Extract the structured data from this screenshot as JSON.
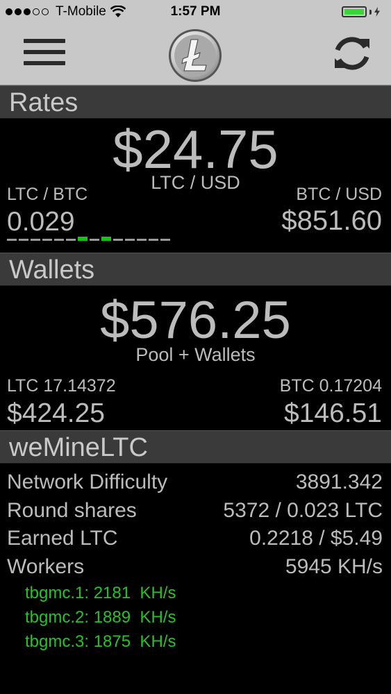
{
  "status_bar": {
    "carrier": "T-Mobile",
    "time": "1:57 PM",
    "signal_dots_filled": 3,
    "signal_dots_total": 5,
    "wifi_icon": "wifi-icon",
    "battery_level": 1.0,
    "battery_color": "#35d835"
  },
  "nav": {
    "menu_icon": "hamburger-menu-icon",
    "logo_icon": "litecoin-logo-icon",
    "refresh_icon": "refresh-icon"
  },
  "rates": {
    "header": "Rates",
    "ltc_usd_value": "$24.75",
    "ltc_usd_label": "LTC / USD",
    "ltc_btc_label": "LTC / BTC",
    "ltc_btc_value": "0.029",
    "btc_usd_label": "BTC / USD",
    "btc_usd_value": "$851.60",
    "sparkline": [
      0,
      0,
      0,
      0,
      0,
      0,
      1,
      0,
      1,
      0,
      0,
      0,
      0,
      0
    ],
    "sparkline_up_color": "#19c119"
  },
  "wallets": {
    "header": "Wallets",
    "total_value": "$576.25",
    "total_label": "Pool + Wallets",
    "ltc_label": "LTC 17.14372",
    "ltc_value": "$424.25",
    "btc_label": "BTC 0.17204",
    "btc_value": "$146.51"
  },
  "pool": {
    "header": "weMineLTC",
    "rows": [
      {
        "label": "Network Difficulty",
        "value": "3891.342"
      },
      {
        "label": "Round shares",
        "value": "5372 / 0.023 LTC"
      },
      {
        "label": "Earned LTC",
        "value": "0.2218 / $5.49"
      },
      {
        "label": "Workers",
        "value": "5945 KH/s"
      }
    ],
    "workers": [
      "tbgmc.1: 2181  KH/s",
      "tbgmc.2: 1889  KH/s",
      "tbgmc.3: 1875  KH/s"
    ],
    "worker_color": "#27c227"
  }
}
